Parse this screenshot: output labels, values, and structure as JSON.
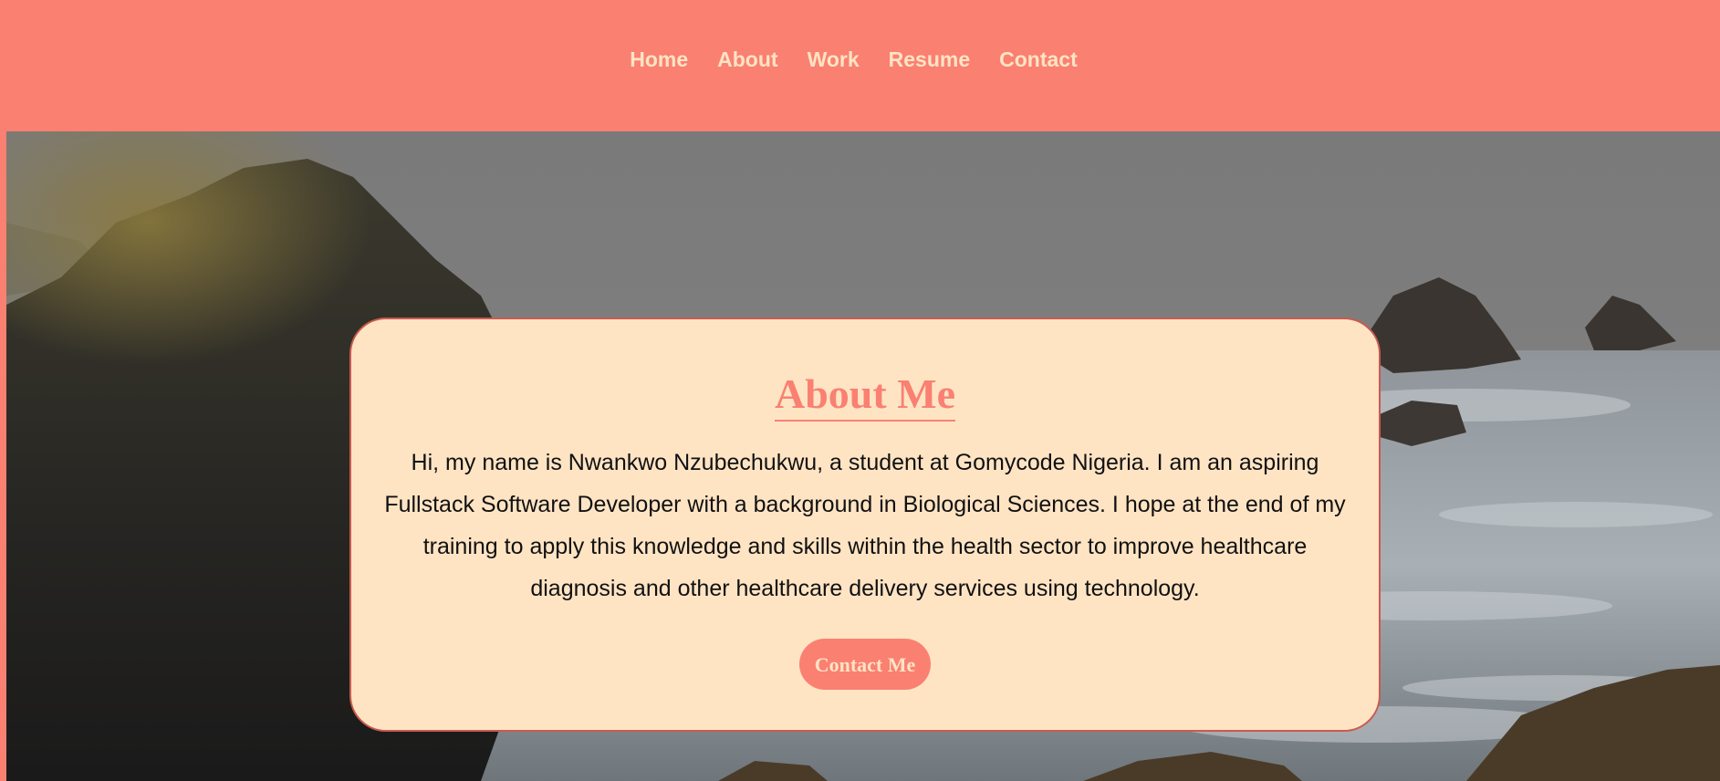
{
  "nav": {
    "items": [
      "Home",
      "About",
      "Work",
      "Resume",
      "Contact"
    ]
  },
  "about": {
    "title": "About Me",
    "body": "Hi, my name is Nwankwo Nzubechukwu, a student at Gomycode Nigeria. I am an aspiring Fullstack Software Developer with a background in Biological Sciences. I hope at the end of my training to apply this knowledge and skills within the health sector to improve healthcare diagnosis and other healthcare delivery services using technology.",
    "button_label": "Contact Me"
  },
  "colors": {
    "accent": "#fa8072",
    "card_bg": "#ffe4c4",
    "nav_text": "#ffe4c4",
    "body_text": "#111111"
  }
}
